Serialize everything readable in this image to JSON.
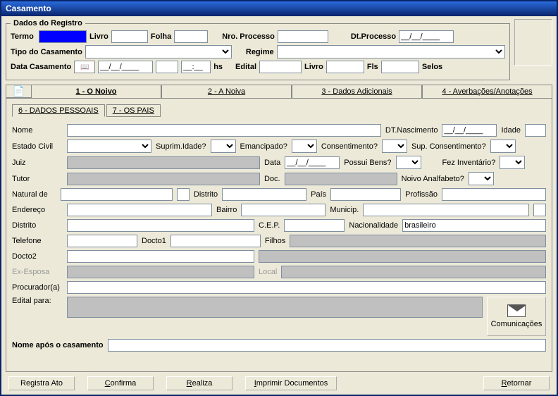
{
  "window_title": "Casamento",
  "registro": {
    "legend": "Dados do Registro",
    "termo_label": "Termo",
    "termo_value": "",
    "livro_label": "Livro",
    "livro_value": "",
    "folha_label": "Folha",
    "folha_value": "",
    "nro_processo_label": "Nro. Processo",
    "nro_processo_value": "",
    "dt_processo_label": "Dt.Processo",
    "dt_processo_value": "__/__/____",
    "tipo_casamento_label": "Tipo do Casamento",
    "regime_label": "Regime",
    "data_casamento_label": "Data Casamento",
    "data_casamento_value": "__/__/____",
    "hora_value": "__:__",
    "hs_label": "hs",
    "edital_label": "Edital",
    "edital_value": "",
    "livro2_label": "Livro",
    "livro2_value": "",
    "fls_label": "Fls",
    "fls_value": "",
    "selos_label": "Selos"
  },
  "maintabs": [
    {
      "label": "1 - O Noivo"
    },
    {
      "label": "2 - A Noiva"
    },
    {
      "label": "3 - Dados Adicionais"
    },
    {
      "label": "4 - Averbações/Anotações"
    }
  ],
  "subtabs": [
    {
      "label": "6 - DADOS PESSOAIS"
    },
    {
      "label": "7 - OS PAIS"
    }
  ],
  "form": {
    "nome_label": "Nome",
    "nome_value": "",
    "dt_nasc_label": "DT.Nascimento",
    "dt_nasc_value": "__/__/____",
    "idade_label": "Idade",
    "idade_value": "",
    "estado_civil_label": "Estado Civil",
    "suprim_idade_label": "Suprim.Idade?",
    "emancipado_label": "Emancipado?",
    "consentimento_label": "Consentimento?",
    "sup_consentimento_label": "Sup. Consentimento?",
    "juiz_label": "Juiz",
    "data_label": "Data",
    "data_value": "__/__/____",
    "possui_bens_label": "Possui Bens?",
    "fez_inventario_label": "Fez Inventário?",
    "tutor_label": "Tutor",
    "doc_label": "Doc.",
    "noivo_analfabeto_label": "Noivo Analfabeto?",
    "natural_de_label": "Natural de",
    "distrito_label": "Distrito",
    "pais_label": "País",
    "profissao_label": "Profissão",
    "endereco_label": "Endereço",
    "bairro_label": "Bairro",
    "municip_label": "Municip.",
    "distrito2_label": "Distrito",
    "cep_label": "C.E.P.",
    "nacionalidade_label": "Nacionalidade",
    "nacionalidade_value": "brasileiro",
    "telefone_label": "Telefone",
    "docto1_label": "Docto1",
    "filhos_label": "Filhos",
    "docto2_label": "Docto2",
    "ex_esposa_label": "Ex-Esposa",
    "local_label": "Local",
    "procurador_label": "Procurador(a)",
    "edital_para_label": "Edital para:",
    "nome_apos_label": "Nome após o casamento",
    "comunicacoes_label": "Comunicações"
  },
  "buttons": {
    "registra_ato": "Registra Ato",
    "confirma": "Confirma",
    "confirma_accel": "C",
    "realiza": "Realiza",
    "realiza_accel": "R",
    "imprimir_docs": "Imprimir Documentos",
    "imprimir_accel": "I",
    "retornar": "Retornar",
    "retornar_accel": "R"
  }
}
